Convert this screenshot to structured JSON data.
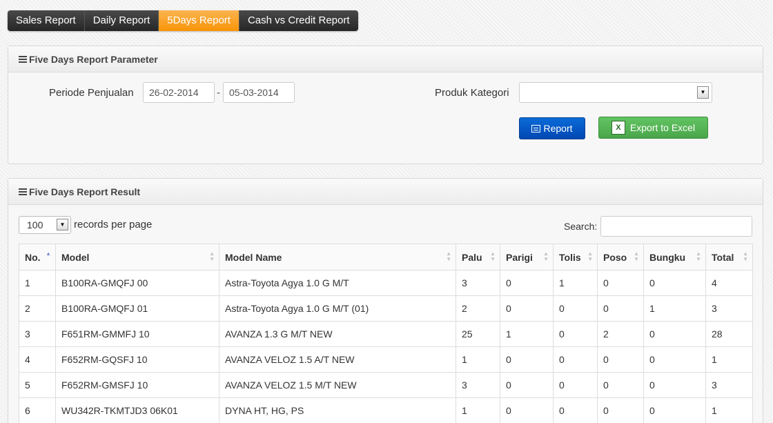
{
  "tabs": [
    {
      "label": "Sales Report",
      "active": false
    },
    {
      "label": "Daily Report",
      "active": false
    },
    {
      "label": "5Days Report",
      "active": true
    },
    {
      "label": "Cash vs Credit Report",
      "active": false
    }
  ],
  "param_panel": {
    "title": "Five Days Report Parameter",
    "period_label": "Periode Penjualan",
    "date_from": "26-02-2014",
    "date_separator": "-",
    "date_to": "05-03-2014",
    "category_label": "Produk Kategori",
    "category_value": "",
    "report_button": "Report",
    "export_button": "Export to Excel"
  },
  "result_panel": {
    "title": "Five Days Report Result",
    "page_size": "100",
    "records_label": "records per page",
    "search_label": "Search:",
    "search_value": ""
  },
  "table": {
    "columns": [
      "No.",
      "Model",
      "Model Name",
      "Palu",
      "Parigi",
      "Tolis",
      "Poso",
      "Bungku",
      "Total"
    ],
    "rows": [
      [
        "1",
        "B100RA-GMQFJ 00",
        "Astra-Toyota Agya 1.0 G M/T",
        "3",
        "0",
        "1",
        "0",
        "0",
        "4"
      ],
      [
        "2",
        "B100RA-GMQFJ 01",
        "Astra-Toyota Agya 1.0 G M/T (01)",
        "2",
        "0",
        "0",
        "0",
        "1",
        "3"
      ],
      [
        "3",
        "F651RM-GMMFJ 10",
        "AVANZA 1.3 G M/T NEW",
        "25",
        "1",
        "0",
        "2",
        "0",
        "28"
      ],
      [
        "4",
        "F652RM-GQSFJ 10",
        "AVANZA VELOZ 1.5 A/T NEW",
        "1",
        "0",
        "0",
        "0",
        "0",
        "1"
      ],
      [
        "5",
        "F652RM-GMSFJ 10",
        "AVANZA VELOZ 1.5 M/T NEW",
        "3",
        "0",
        "0",
        "0",
        "0",
        "3"
      ],
      [
        "6",
        "WU342R-TKMTJD3 06K01",
        "DYNA HT, HG, PS",
        "1",
        "0",
        "0",
        "0",
        "0",
        "1"
      ]
    ]
  },
  "colors": {
    "tab_active": "#f89406",
    "tab_dark": "#333333",
    "report_button": "#0058c7",
    "export_button": "#5bb75b"
  }
}
